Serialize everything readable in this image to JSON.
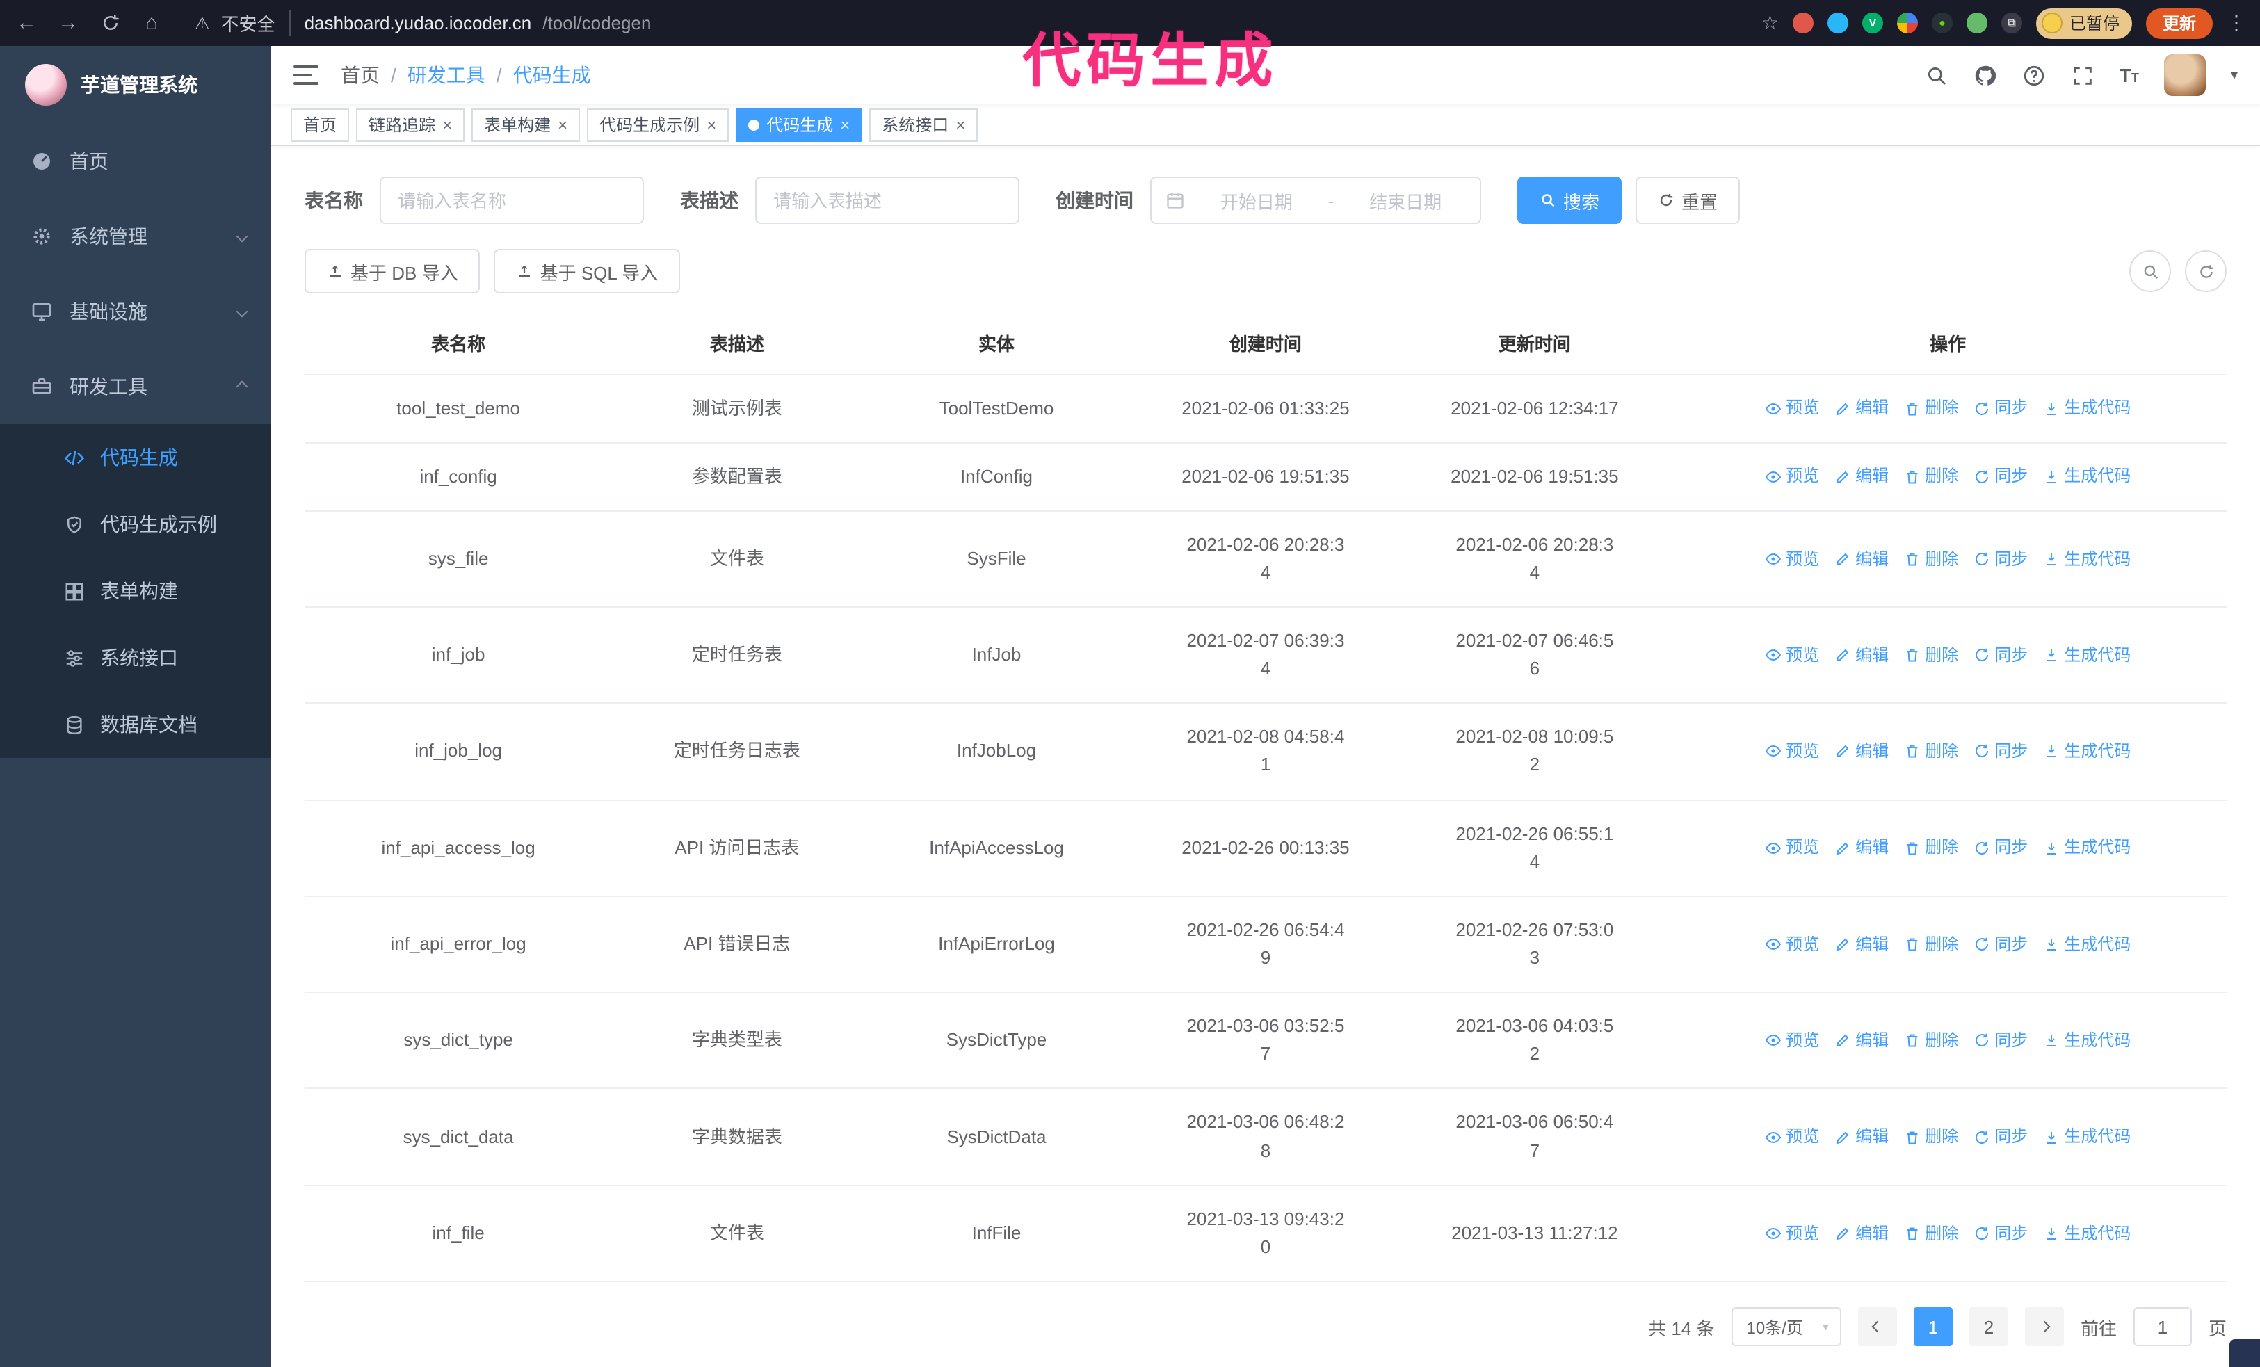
{
  "theme": {
    "accent": "#409eff",
    "sidebar_bg": "#304156",
    "submenu_bg": "#1f2d3d",
    "annotation_color": "#f5317f"
  },
  "browser": {
    "security_warning": "不安全",
    "url_host": "dashboard.yudao.iocoder.cn",
    "url_path": "/tool/codegen",
    "profile_badge": "已暂停",
    "update_button": "更新"
  },
  "annotation": {
    "text": "代码生成"
  },
  "sidebar": {
    "logo_title": "芋道管理系统",
    "items": [
      {
        "label": "首页"
      },
      {
        "label": "系统管理"
      },
      {
        "label": "基础设施"
      },
      {
        "label": "研发工具"
      }
    ],
    "subitems": [
      {
        "label": "代码生成",
        "active": true
      },
      {
        "label": "代码生成示例"
      },
      {
        "label": "表单构建"
      },
      {
        "label": "系统接口"
      },
      {
        "label": "数据库文档"
      }
    ]
  },
  "header": {
    "breadcrumb": [
      "首页",
      "研发工具",
      "代码生成"
    ],
    "separator": "/"
  },
  "tabs": [
    {
      "label": "首页",
      "closable": false,
      "active": false
    },
    {
      "label": "链路追踪",
      "closable": true,
      "active": false
    },
    {
      "label": "表单构建",
      "closable": true,
      "active": false
    },
    {
      "label": "代码生成示例",
      "closable": true,
      "active": false
    },
    {
      "label": "代码生成",
      "closable": true,
      "active": true
    },
    {
      "label": "系统接口",
      "closable": true,
      "active": false
    }
  ],
  "filters": {
    "table_name_label": "表名称",
    "table_name_placeholder": "请输入表名称",
    "table_desc_label": "表描述",
    "table_desc_placeholder": "请输入表描述",
    "create_time_label": "创建时间",
    "date_start_placeholder": "开始日期",
    "date_separator": "-",
    "date_end_placeholder": "结束日期",
    "search_button": "搜索",
    "reset_button": "重置"
  },
  "toolbar": {
    "import_db_label": "基于 DB 导入",
    "import_sql_label": "基于 SQL 导入"
  },
  "table": {
    "columns": [
      "表名称",
      "表描述",
      "实体",
      "创建时间",
      "更新时间",
      "操作"
    ],
    "actions": [
      "预览",
      "编辑",
      "删除",
      "同步",
      "生成代码"
    ],
    "rows": [
      {
        "name": "tool_test_demo",
        "desc": "测试示例表",
        "entity": "ToolTestDemo",
        "created": "2021-02-06 01:33:25",
        "updated": "2021-02-06 12:34:17"
      },
      {
        "name": "inf_config",
        "desc": "参数配置表",
        "entity": "InfConfig",
        "created": "2021-02-06 19:51:35",
        "updated": "2021-02-06 19:51:35"
      },
      {
        "name": "sys_file",
        "desc": "文件表",
        "entity": "SysFile",
        "created": "2021-02-06 20:28:3\n4",
        "updated": "2021-02-06 20:28:3\n4"
      },
      {
        "name": "inf_job",
        "desc": "定时任务表",
        "entity": "InfJob",
        "created": "2021-02-07 06:39:3\n4",
        "updated": "2021-02-07 06:46:5\n6"
      },
      {
        "name": "inf_job_log",
        "desc": "定时任务日志表",
        "entity": "InfJobLog",
        "created": "2021-02-08 04:58:4\n1",
        "updated": "2021-02-08 10:09:5\n2"
      },
      {
        "name": "inf_api_access_log",
        "desc": "API 访问日志表",
        "entity": "InfApiAccessLog",
        "created": "2021-02-26 00:13:35",
        "updated": "2021-02-26 06:55:1\n4"
      },
      {
        "name": "inf_api_error_log",
        "desc": "API 错误日志",
        "entity": "InfApiErrorLog",
        "created": "2021-02-26 06:54:4\n9",
        "updated": "2021-02-26 07:53:0\n3"
      },
      {
        "name": "sys_dict_type",
        "desc": "字典类型表",
        "entity": "SysDictType",
        "created": "2021-03-06 03:52:5\n7",
        "updated": "2021-03-06 04:03:5\n2"
      },
      {
        "name": "sys_dict_data",
        "desc": "字典数据表",
        "entity": "SysDictData",
        "created": "2021-03-06 06:48:2\n8",
        "updated": "2021-03-06 06:50:4\n7"
      },
      {
        "name": "inf_file",
        "desc": "文件表",
        "entity": "InfFile",
        "created": "2021-03-13 09:43:2\n0",
        "updated": "2021-03-13 11:27:12"
      }
    ]
  },
  "pagination": {
    "total_text": "共 14 条",
    "page_size": "10条/页",
    "pages": [
      "1",
      "2"
    ],
    "goto_label": "前往",
    "goto_value": "1",
    "goto_suffix": "页"
  }
}
